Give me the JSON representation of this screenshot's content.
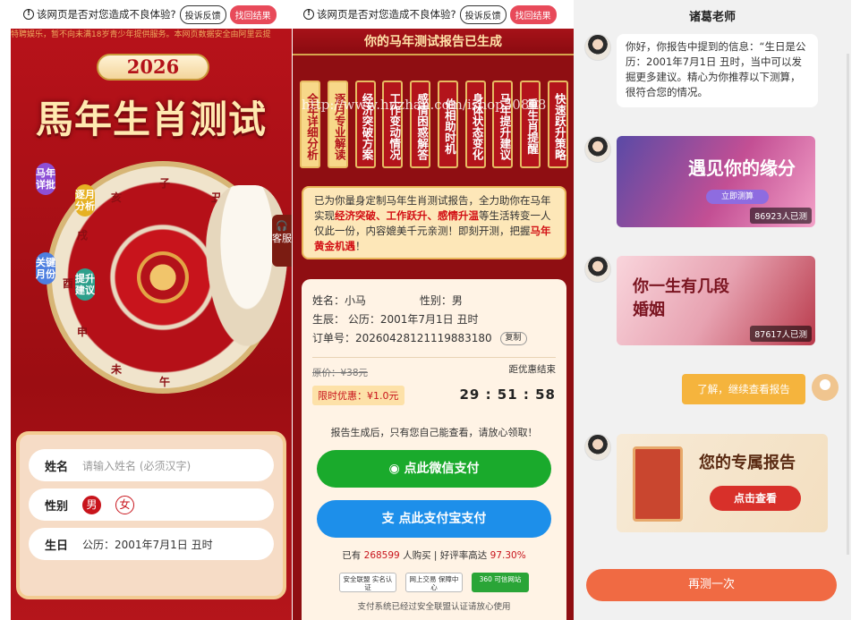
{
  "common": {
    "warning_text": "该网页是否对您造成不良体验?",
    "complain_btn": "投诉反馈",
    "find_btn": "找回结果"
  },
  "left": {
    "marquee": "特聘娱乐，暂不向未满18岁青少年提供服务。本网页数据安全由阿里云提",
    "year": "2026",
    "title": "馬年生肖测试",
    "pills": [
      "马年详批",
      "逐月分析",
      "关键月份",
      "提升建议"
    ],
    "kefu": "客服",
    "zodiac": [
      "子",
      "丑",
      "寅",
      "卯",
      "辰",
      "巳",
      "午",
      "未",
      "申",
      "酉",
      "戌",
      "亥"
    ],
    "form": {
      "name_label": "姓名",
      "name_placeholder": "请输入姓名 (必须汉字)",
      "gender_label": "性别",
      "male": "男",
      "female": "女",
      "birth_label": "生日",
      "birth_value": "公历：2001年7月1日 丑时"
    }
  },
  "middle": {
    "header": "你的马年测试报告已生成",
    "scrolls": [
      "全年详细分析",
      "逐月专业解读",
      "经济突破方案",
      "工作变动情况",
      "感情困惑解答",
      "伯相助时机",
      "身体状态变化",
      "马年提升建议",
      "重生肖提醒",
      "快速跃升策略"
    ],
    "watermark": "http://www.huzhan.com/ishop50898",
    "promo_pre": "已为你量身定制马年生肖测试报告，全力助你在马年实现",
    "promo_hl1": "经济突破、工作跃升、感情升温",
    "promo_mid": "等生活转变一人仅此一份，内容媲美千元亲测！即刻开测，把握",
    "promo_hl2": "马年黄金机遇",
    "promo_end": "！",
    "name_line": "姓名：小马",
    "gender_line": "性别：男",
    "birth_line": "生辰：  公历：2001年7月1日 丑时",
    "order_line": "订单号：20260428121119883180",
    "copy": "复制",
    "orig_price": "原价：¥38元",
    "deadline_label": "距优惠结束",
    "discount": "限时优惠：¥1.0元",
    "timer": "29 : 51 : 58",
    "tip": "报告生成后，只有您自己能查看，请放心领取！",
    "wechat_pay": "点此微信支付",
    "alipay": "点此支付宝支付",
    "stat_pre": "已有",
    "stat_count": "268599",
    "stat_mid": "人购买 | 好评率高达",
    "stat_rate": "97.30%",
    "badges": [
      "安全联盟 实名认证",
      "网上交易 保障中心",
      "360 可信网站"
    ],
    "footer": "支付系统已经过安全联盟认证请放心使用"
  },
  "right": {
    "title": "诸葛老师",
    "msg1": "你好，你报告中提到的信息：“生日是公历：2001年7月1日 丑时，当中可以发掘更多建议。精心为你推荐以下测算，很符合您的情况。",
    "card1_title": "遇见你的缘分",
    "card1_btn": "立即测算",
    "card1_count": "86923人已测",
    "card2_title": "你一生有几段婚姻",
    "card2_count": "87617人已测",
    "user_reply": "了解，继续查看报告",
    "card3_title": "您的专属报告",
    "card3_btn": "点击查看",
    "redo": "再测一次"
  },
  "colors": {
    "brand_red": "#b3121a",
    "gold": "#e7bb62",
    "wechat_green": "#1aaa2c",
    "alipay_blue": "#1d8fea",
    "cta_orange": "#f06a43"
  }
}
